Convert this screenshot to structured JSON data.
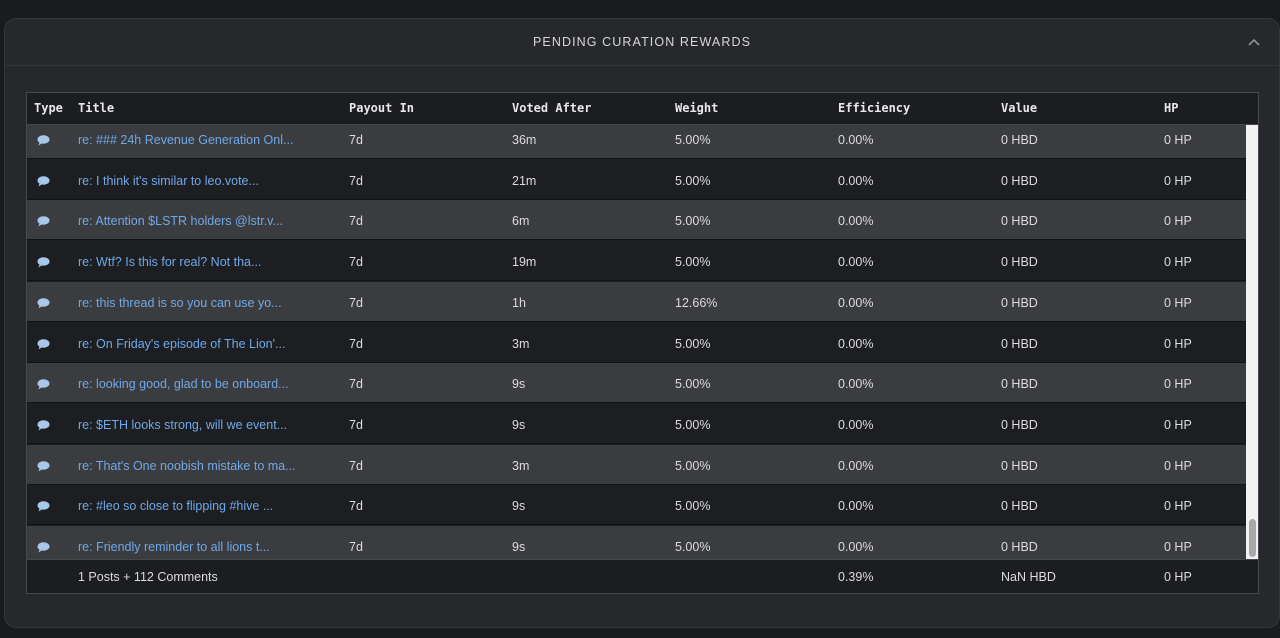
{
  "header": {
    "title": "PENDING CURATION REWARDS",
    "collapse_icon": "chevron-up-icon"
  },
  "columns": {
    "type": "Type",
    "title": "Title",
    "payout_in": "Payout In",
    "voted_after": "Voted After",
    "weight": "Weight",
    "efficiency": "Efficiency",
    "value": "Value",
    "hp": "HP"
  },
  "rows": [
    {
      "type": "comment-icon",
      "title": "re: ### 24h Revenue Generation Onl...",
      "payout_in": "7d",
      "voted_after": "36m",
      "weight": "5.00%",
      "efficiency": "0.00%",
      "value": "0 HBD",
      "hp": "0 HP"
    },
    {
      "type": "comment-icon",
      "title": "re: I think it's similar to leo.vote...",
      "payout_in": "7d",
      "voted_after": "21m",
      "weight": "5.00%",
      "efficiency": "0.00%",
      "value": "0 HBD",
      "hp": "0 HP"
    },
    {
      "type": "comment-icon",
      "title": "re: Attention $LSTR holders @lstr.v...",
      "payout_in": "7d",
      "voted_after": "6m",
      "weight": "5.00%",
      "efficiency": "0.00%",
      "value": "0 HBD",
      "hp": "0 HP"
    },
    {
      "type": "comment-icon",
      "title": "re: Wtf? Is this for real? Not tha...",
      "payout_in": "7d",
      "voted_after": "19m",
      "weight": "5.00%",
      "efficiency": "0.00%",
      "value": "0 HBD",
      "hp": "0 HP"
    },
    {
      "type": "comment-icon",
      "title": "re: this thread is so you can use yo...",
      "payout_in": "7d",
      "voted_after": "1h",
      "weight": "12.66%",
      "efficiency": "0.00%",
      "value": "0 HBD",
      "hp": "0 HP"
    },
    {
      "type": "comment-icon",
      "title": "re: On Friday's episode of The Lion'...",
      "payout_in": "7d",
      "voted_after": "3m",
      "weight": "5.00%",
      "efficiency": "0.00%",
      "value": "0 HBD",
      "hp": "0 HP"
    },
    {
      "type": "comment-icon",
      "title": "re: looking good, glad to be onboard...",
      "payout_in": "7d",
      "voted_after": "9s",
      "weight": "5.00%",
      "efficiency": "0.00%",
      "value": "0 HBD",
      "hp": "0 HP"
    },
    {
      "type": "comment-icon",
      "title": "re: $ETH looks strong, will we event...",
      "payout_in": "7d",
      "voted_after": "9s",
      "weight": "5.00%",
      "efficiency": "0.00%",
      "value": "0 HBD",
      "hp": "0 HP"
    },
    {
      "type": "comment-icon",
      "title": "re: That's One noobish mistake to ma...",
      "payout_in": "7d",
      "voted_after": "3m",
      "weight": "5.00%",
      "efficiency": "0.00%",
      "value": "0 HBD",
      "hp": "0 HP"
    },
    {
      "type": "comment-icon",
      "title": "re: #leo so close to flipping #hive ...",
      "payout_in": "7d",
      "voted_after": "9s",
      "weight": "5.00%",
      "efficiency": "0.00%",
      "value": "0 HBD",
      "hp": "0 HP"
    },
    {
      "type": "comment-icon",
      "title": "re: Friendly reminder to all lions t...",
      "payout_in": "7d",
      "voted_after": "9s",
      "weight": "5.00%",
      "efficiency": "0.00%",
      "value": "0 HBD",
      "hp": "0 HP"
    }
  ],
  "footer": {
    "summary": "1 Posts + 112 Comments",
    "efficiency": "0.39%",
    "value": "NaN HBD",
    "hp": "0 HP"
  },
  "colors": {
    "link": "#6fa8e8",
    "row_alt": "#3b3c40",
    "row_base": "#1d1e21"
  }
}
